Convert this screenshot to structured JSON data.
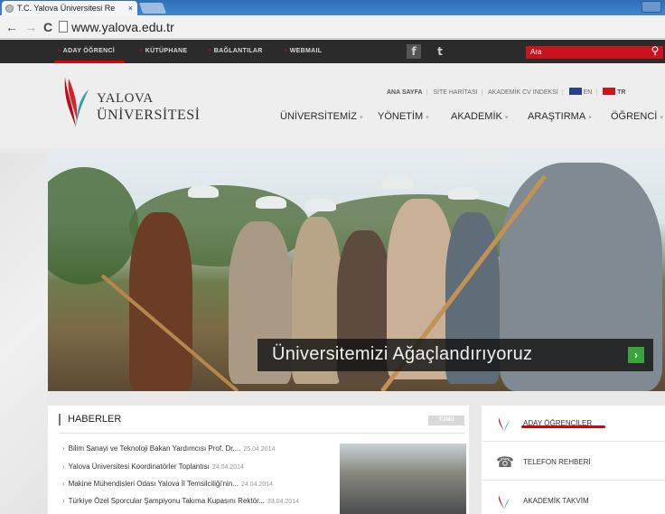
{
  "browser": {
    "tab_title": "T.C. Yalova Üniversitesi Re",
    "tab_close": "×",
    "url": "www.yalova.edu.tr",
    "back": "←",
    "forward": "→",
    "reload": "C"
  },
  "topbar": {
    "links": [
      "ADAY ÖĞRENCİ",
      "KÜTÜPHANE",
      "BAĞLANTILAR",
      "WEBMAIL"
    ],
    "facebook": "f",
    "twitter": "t",
    "search_placeholder": "Ara",
    "search_icon": "search-icon"
  },
  "header": {
    "logo_line1": "YALOVA",
    "logo_line2": "ÜNİVERSİTESİ",
    "util_links": [
      "ANA SAYFA",
      "SİTE HARİTASI",
      "AKADEMİK CV İNDEKSİ"
    ],
    "lang_en": "EN",
    "lang_tr": "TR",
    "nav": [
      "ÜNİVERSİTEMİZ",
      "YÖNETİM",
      "AKADEMİK",
      "ARAŞTIRMA",
      "ÖĞRENCİ"
    ]
  },
  "hero": {
    "caption": "Üniversitemizi Ağaçlandırıyoruz",
    "next": "›"
  },
  "news": {
    "heading": "HABERLER",
    "more": "TÜMÜ",
    "items": [
      {
        "title": "Bilim Sanayi ve Teknoloji Bakan Yardımcısı Prof. Dr....",
        "date": "25.04.2014"
      },
      {
        "title": "Yalova Üniversitesi Koordinatörler Toplantısı",
        "date": "24.04.2014"
      },
      {
        "title": "Makine Mühendisleri Odası Yalova İl Temsilciliği'nin...",
        "date": "24.04.2014"
      },
      {
        "title": "Türkiye Özel Sporcular Şampiyonu Takıma Kupasını Rektör...",
        "date": "23.04.2014"
      }
    ]
  },
  "sidebar": {
    "items": [
      "ADAY ÖĞRENCİLER",
      "TELEFON REHBERİ",
      "AKADEMİK TAKVİM"
    ]
  },
  "colors": {
    "brand_red": "#c9141d",
    "dark": "#2b2b2b",
    "accent_green": "#3aa33c"
  }
}
